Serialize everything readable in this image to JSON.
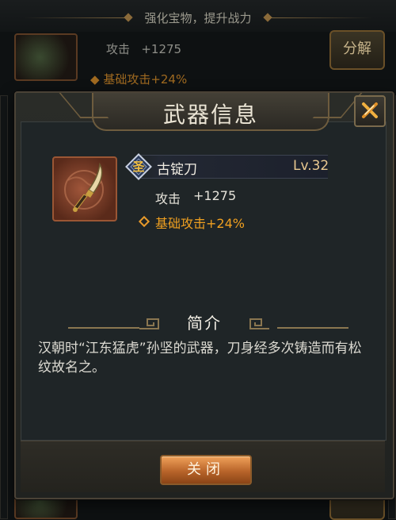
{
  "background": {
    "subtitle": "强化宝物，提升战力",
    "item_attack_label": "攻击",
    "item_attack_value": "+1275",
    "item_bonus": "基础攻击+24%",
    "decompose_label": "分解"
  },
  "dialog": {
    "title": "武器信息",
    "close_icon": "close-x-icon",
    "weapon": {
      "grade_badge": "圣",
      "name": "古锭刀",
      "level": "Lv.32",
      "attack_label": "攻击",
      "attack_value": "+1275",
      "bonus": "基础攻击+24%"
    },
    "intro": {
      "heading": "简介",
      "text": "汉朝时“江东猛虎”孙坚的武器，刀身经多次铸造而有松纹故名之。"
    },
    "close_button_label": "关闭"
  },
  "colors": {
    "accent_gold": "#f0a020",
    "button_orange": "#c8702e",
    "frame_border": "#6e5c3e"
  }
}
